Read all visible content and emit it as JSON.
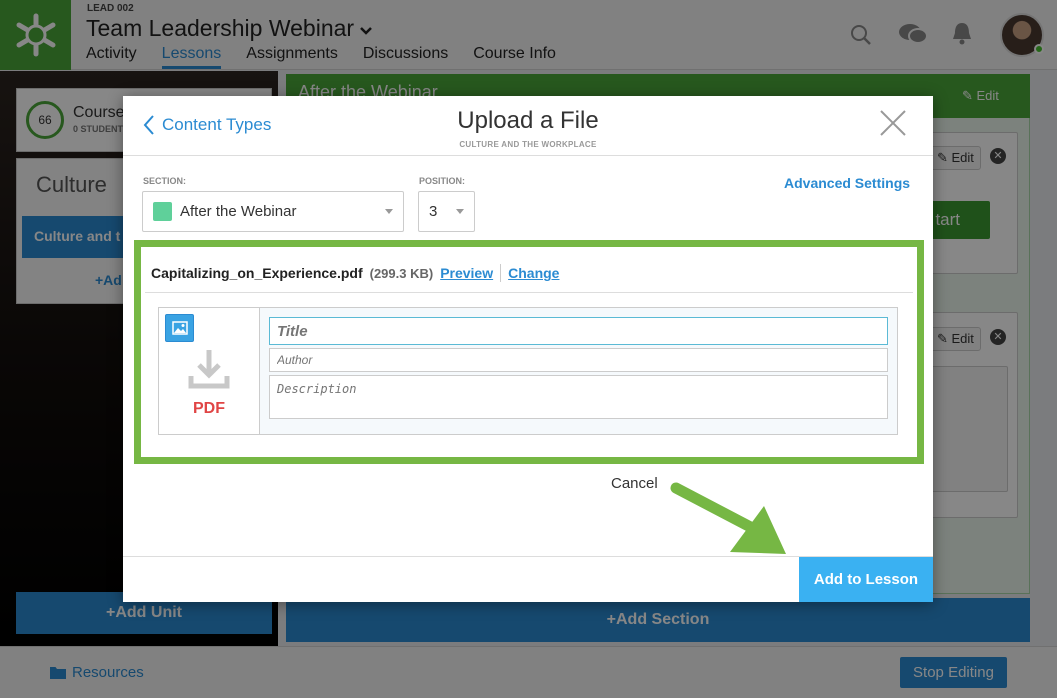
{
  "header": {
    "course_code": "LEAD 002",
    "course_title": "Team Leadership Webinar",
    "tabs": [
      "Activity",
      "Lessons",
      "Assignments",
      "Discussions",
      "Course Info"
    ],
    "active_tab": "Lessons",
    "icons": [
      "search-icon",
      "chat-icon",
      "bell-icon"
    ]
  },
  "left_panel": {
    "progress": "66",
    "card_title": "Course",
    "card_sub": "0 STUDENT",
    "unit_title": "Culture",
    "unit_item": "Culture and t",
    "add_link": "+Ad",
    "add_unit": "+Add Unit"
  },
  "section": {
    "title": "After the Webinar",
    "edit": "Edit",
    "start": "tart",
    "add_section": "+Add Section"
  },
  "footer": {
    "resources": "Resources",
    "stop_editing": "Stop Editing"
  },
  "modal": {
    "back_label": "Content Types",
    "title": "Upload a File",
    "subtitle": "CULTURE AND THE WORKPLACE",
    "section_label": "SECTION:",
    "section_value": "After the Webinar",
    "section_color": "#5fd09a",
    "position_label": "POSITION:",
    "position_value": "3",
    "advanced_settings": "Advanced Settings",
    "file": {
      "name": "Capitalizing_on_Experience.pdf",
      "size": "(299.3 KB)",
      "preview": "Preview",
      "change": "Change",
      "type_label": "PDF"
    },
    "fields": {
      "title_placeholder": "Title",
      "author_placeholder": "Author",
      "description_placeholder": "Description"
    },
    "cancel": "Cancel",
    "add_to_lesson": "Add to Lesson"
  },
  "colors": {
    "brand_green": "#4aa63a",
    "accent_blue": "#2b8bd2",
    "highlight_green": "#76b744",
    "pdf_red": "#e04545"
  }
}
